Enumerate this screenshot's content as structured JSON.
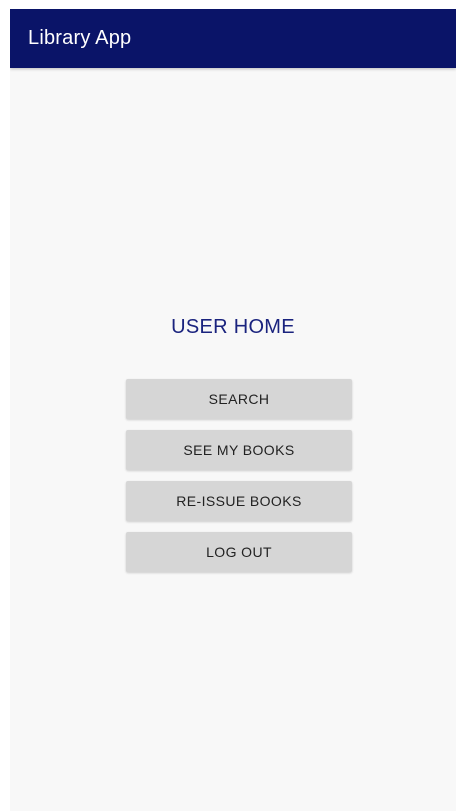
{
  "app_bar": {
    "title": "Library App",
    "color": "#0a1468"
  },
  "main": {
    "title": "USER HOME",
    "buttons": [
      {
        "label": "SEARCH"
      },
      {
        "label": "SEE MY BOOKS"
      },
      {
        "label": "RE-ISSUE BOOKS"
      },
      {
        "label": "LOG OUT"
      }
    ]
  }
}
